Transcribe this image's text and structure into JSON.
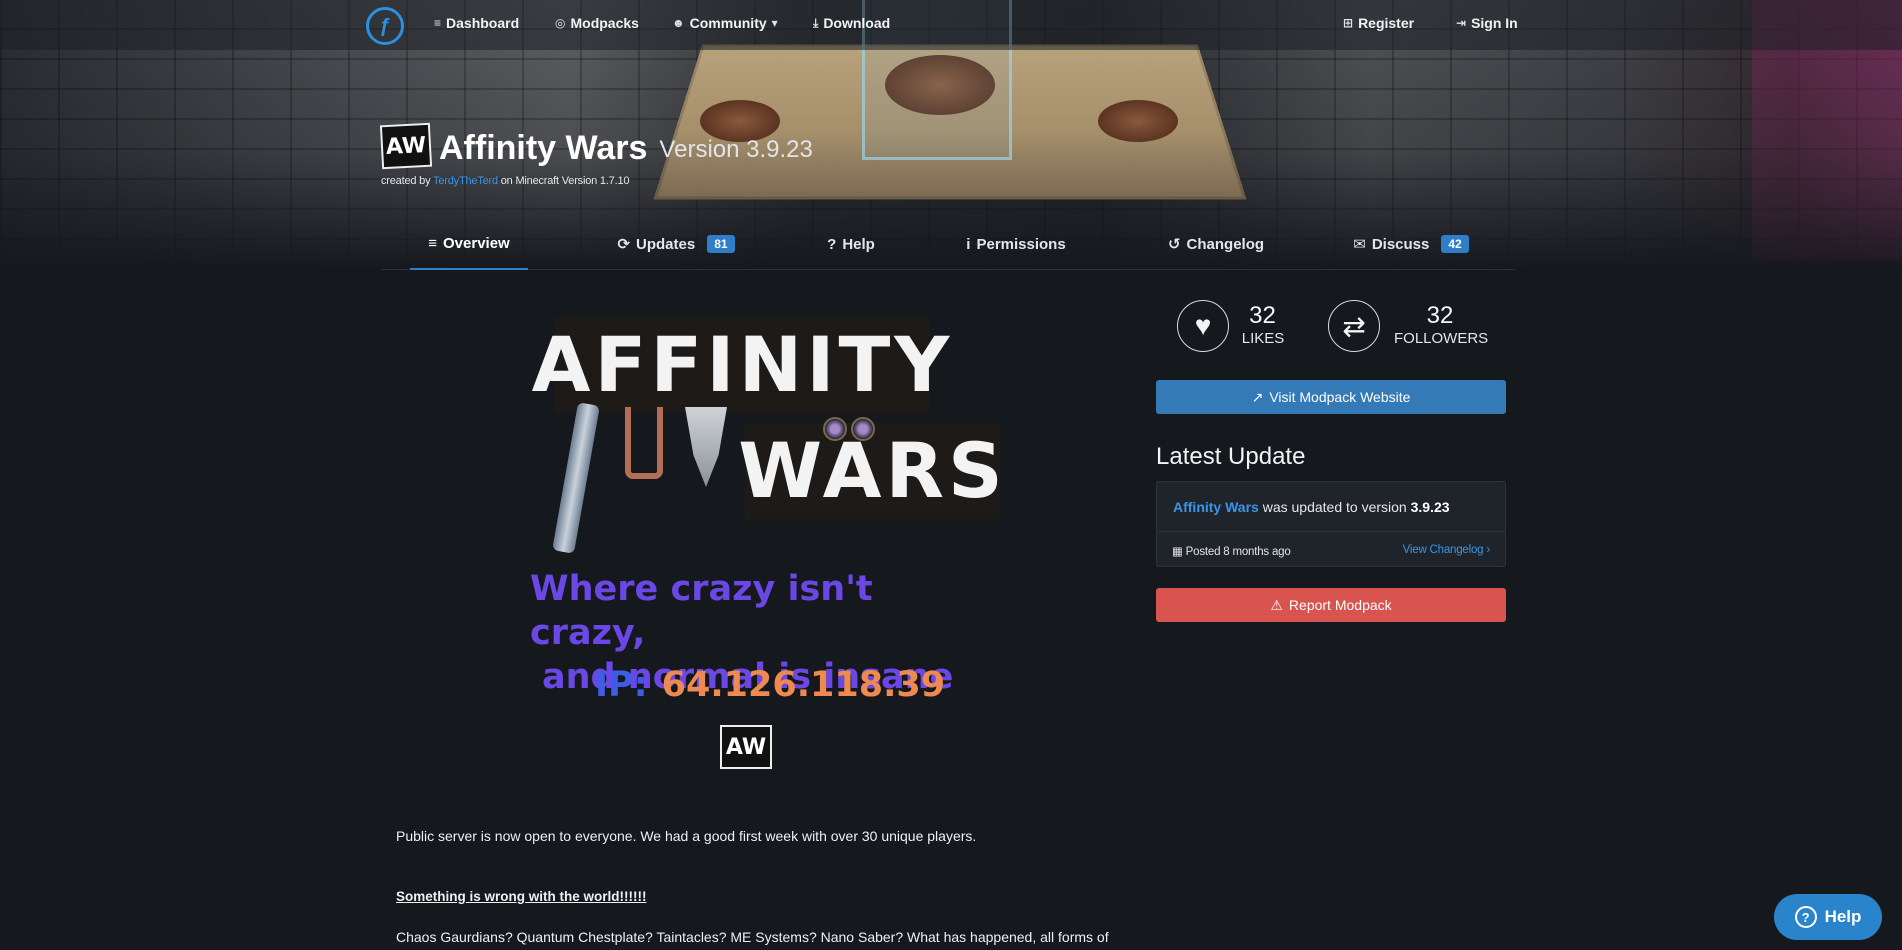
{
  "nav": {
    "logo_icon": "curseforge-logo",
    "items": [
      {
        "label": "Dashboard",
        "icon": "rss-icon",
        "glyph": "≡"
      },
      {
        "label": "Modpacks",
        "icon": "modpack-icon",
        "glyph": "◎"
      },
      {
        "label": "Community",
        "icon": "users-icon",
        "glyph": "☻",
        "caret": "▾"
      },
      {
        "label": "Download",
        "icon": "download-icon",
        "glyph": "⤓"
      }
    ],
    "register": {
      "label": "Register",
      "glyph": "⊞"
    },
    "sign_in": {
      "label": "Sign In",
      "glyph": "⇥"
    }
  },
  "pack": {
    "logo_text": "AW",
    "name": "Affinity Wars",
    "version_label": "Version 3.9.23",
    "created_prefix": "created by",
    "author": "TerdyTheTerd",
    "created_suffix": "on Minecraft Version 1.7.10"
  },
  "tabs": [
    {
      "label": "Overview",
      "glyph": "≡",
      "active": true
    },
    {
      "label": "Updates",
      "glyph": "⟳",
      "badge": "81"
    },
    {
      "label": "Help",
      "glyph": "?"
    },
    {
      "label": "Permissions",
      "glyph": "i"
    },
    {
      "label": "Changelog",
      "glyph": "↺"
    },
    {
      "label": "Discuss",
      "glyph": "✉",
      "badge": "42"
    }
  ],
  "banner": {
    "word1": "AFFINITY",
    "word2": "WARS",
    "tagline_1": "Where crazy isn't crazy,",
    "tagline_2": "and normal is insane",
    "ip_label": "IP:",
    "ip_value": "64.126.118.39",
    "aw_text": "AW"
  },
  "description": {
    "intro": "Public server is now open to everyone. We had a good first week with over 30 unique players.",
    "heading": "Something is wrong with the world!!!!!!",
    "para": "Chaos Gaurdians? Quantum Chestplate? Taintacles? ME Systems? Nano Saber? What has happened, all forms of"
  },
  "stats": {
    "likes_count": "32",
    "likes_label": "LIKES",
    "followers_count": "32",
    "followers_label": "FOLLOWERS"
  },
  "sidebar": {
    "visit_label": "Visit Modpack Website",
    "latest_heading": "Latest Update",
    "update_name": "Affinity Wars",
    "update_text": "was updated to version",
    "update_version": "3.9.23",
    "posted": "Posted 8 months ago",
    "view_changelog": "View Changelog ›",
    "report_label": "Report Modpack"
  },
  "help_button": {
    "label": "Help",
    "glyph": "?"
  },
  "colors": {
    "accent": "#337ab7",
    "link": "#3b95e6",
    "danger": "#d9534f",
    "badge": "#2f7fc8",
    "page_bg": "#15181d"
  }
}
